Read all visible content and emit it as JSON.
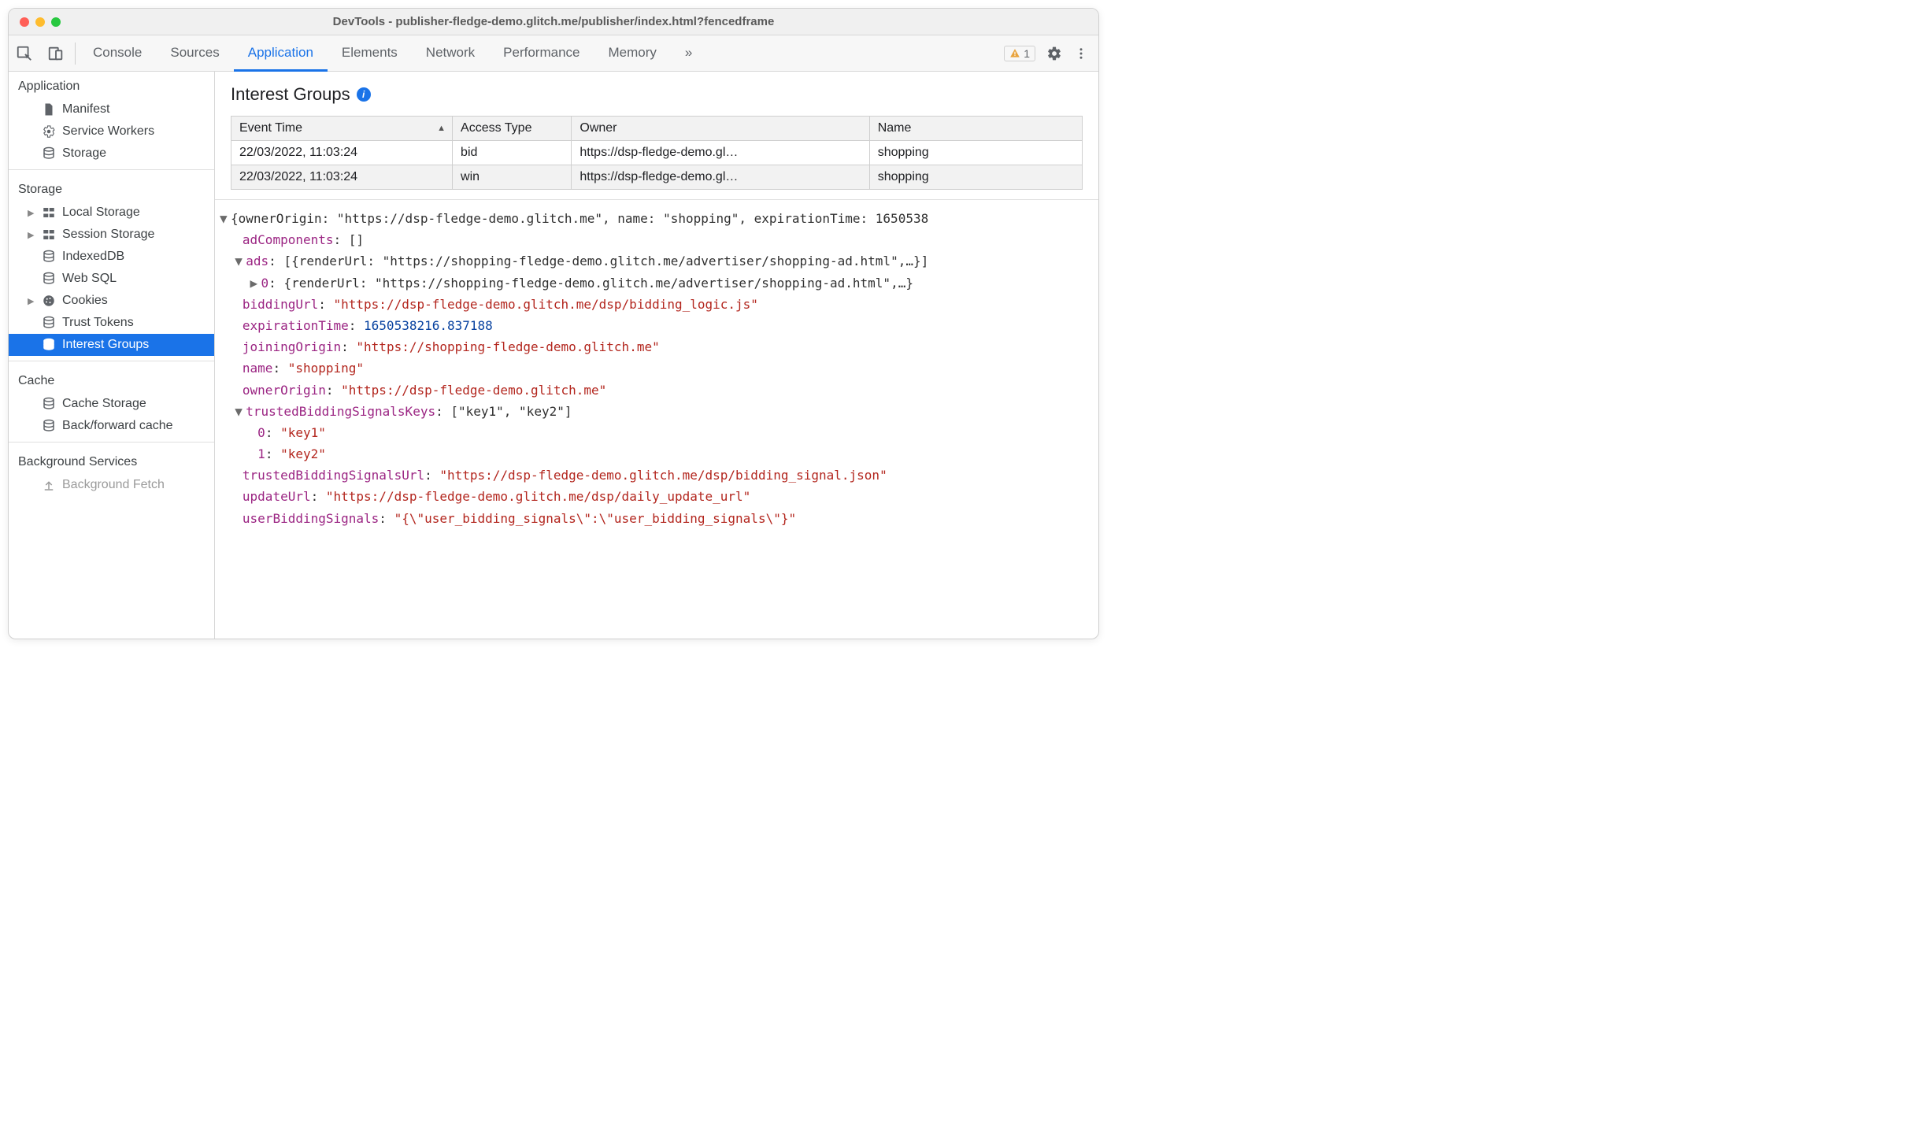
{
  "window": {
    "title": "DevTools - publisher-fledge-demo.glitch.me/publisher/index.html?fencedframe"
  },
  "toolbar": {
    "tabs": [
      "Console",
      "Sources",
      "Application",
      "Elements",
      "Network",
      "Performance",
      "Memory"
    ],
    "active_tab": "Application",
    "more_label": "»",
    "warning_count": "1"
  },
  "sidebar": {
    "groups": [
      {
        "title": "Application",
        "items": [
          {
            "icon": "file",
            "label": "Manifest",
            "caret": false
          },
          {
            "icon": "gear",
            "label": "Service Workers",
            "caret": false
          },
          {
            "icon": "db",
            "label": "Storage",
            "caret": false
          }
        ]
      },
      {
        "title": "Storage",
        "items": [
          {
            "icon": "grid",
            "label": "Local Storage",
            "caret": true
          },
          {
            "icon": "grid",
            "label": "Session Storage",
            "caret": true
          },
          {
            "icon": "db",
            "label": "IndexedDB",
            "caret": false
          },
          {
            "icon": "db",
            "label": "Web SQL",
            "caret": false
          },
          {
            "icon": "cookie",
            "label": "Cookies",
            "caret": true
          },
          {
            "icon": "db",
            "label": "Trust Tokens",
            "caret": false
          },
          {
            "icon": "db",
            "label": "Interest Groups",
            "caret": false,
            "selected": true
          }
        ]
      },
      {
        "title": "Cache",
        "items": [
          {
            "icon": "db",
            "label": "Cache Storage",
            "caret": false
          },
          {
            "icon": "db",
            "label": "Back/forward cache",
            "caret": false
          }
        ]
      },
      {
        "title": "Background Services",
        "items": [
          {
            "icon": "upload",
            "label": "Background Fetch",
            "caret": false
          }
        ]
      }
    ]
  },
  "panel": {
    "title": "Interest Groups",
    "columns": [
      "Event Time",
      "Access Type",
      "Owner",
      "Name"
    ],
    "rows": [
      {
        "time": "22/03/2022, 11:03:24",
        "type": "bid",
        "owner": "https://dsp-fledge-demo.gl…",
        "name": "shopping"
      },
      {
        "time": "22/03/2022, 11:03:24",
        "type": "win",
        "owner": "https://dsp-fledge-demo.gl…",
        "name": "shopping"
      }
    ]
  },
  "detail": {
    "header_line": "{ownerOrigin: \"https://dsp-fledge-demo.glitch.me\", name: \"shopping\", expirationTime: 1650538",
    "adComponents": "[]",
    "ads_summary": "[{renderUrl: \"https://shopping-fledge-demo.glitch.me/advertiser/shopping-ad.html\",…}]",
    "ads_0": "{renderUrl: \"https://shopping-fledge-demo.glitch.me/advertiser/shopping-ad.html\",…}",
    "biddingUrl": "\"https://dsp-fledge-demo.glitch.me/dsp/bidding_logic.js\"",
    "expirationTime": "1650538216.837188",
    "joiningOrigin": "\"https://shopping-fledge-demo.glitch.me\"",
    "name": "\"shopping\"",
    "ownerOrigin": "\"https://dsp-fledge-demo.glitch.me\"",
    "tbsk_summary": "[\"key1\", \"key2\"]",
    "tbsk_0": "\"key1\"",
    "tbsk_1": "\"key2\"",
    "trustedBiddingSignalsUrl": "\"https://dsp-fledge-demo.glitch.me/dsp/bidding_signal.json\"",
    "updateUrl": "\"https://dsp-fledge-demo.glitch.me/dsp/daily_update_url\"",
    "userBiddingSignals": "\"{\\\"user_bidding_signals\\\":\\\"user_bidding_signals\\\"}\""
  }
}
